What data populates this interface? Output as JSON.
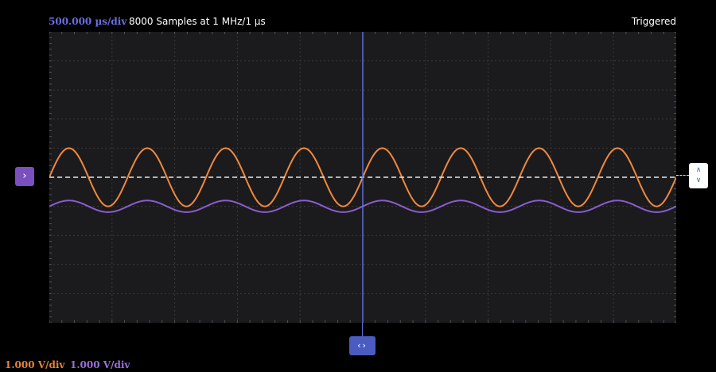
{
  "header": {
    "timebase": "500.000 µs/div",
    "samples": "8000 Samples at 1 MHz/1 µs",
    "trigger_status": "Triggered"
  },
  "footer": {
    "channel_a_scale": "1.000 V/div",
    "channel_b_scale": "1.000 V/div"
  },
  "controls": {
    "channel_marker_icon": "chevron-right-icon",
    "trigger_level_icon": "chevron-up-down-icon",
    "time_cursor_icon": "chevron-left-right-icon"
  },
  "colors": {
    "background": "#000000",
    "plot_background": "#1b1b1d",
    "grid": "#3a3a3e",
    "channel_a": "#f0883e",
    "channel_b": "#8a5cd0",
    "timebase_text": "#6a6ee0",
    "trigger_line": "#e8e8e8",
    "time_cursor": "#5a6fd6"
  },
  "chart_data": {
    "type": "line",
    "x_divisions": 10,
    "y_divisions": 10,
    "timebase_per_div_us": 500,
    "volts_per_div": 1.0,
    "x_range_us": [
      0,
      5000
    ],
    "y_range_div": [
      -5,
      5
    ],
    "grid": true,
    "trigger_level_div": 0.0,
    "time_cursor_us": 2500,
    "series": [
      {
        "channel": "A",
        "color": "#f0883e",
        "waveform": "sine",
        "frequency_hz": 1600,
        "amplitude_div": 1.0,
        "offset_div": 0.0
      },
      {
        "channel": "B",
        "color": "#8a5cd0",
        "waveform": "sine",
        "frequency_hz": 1600,
        "amplitude_div": 0.2,
        "offset_div": -1.0
      }
    ]
  }
}
